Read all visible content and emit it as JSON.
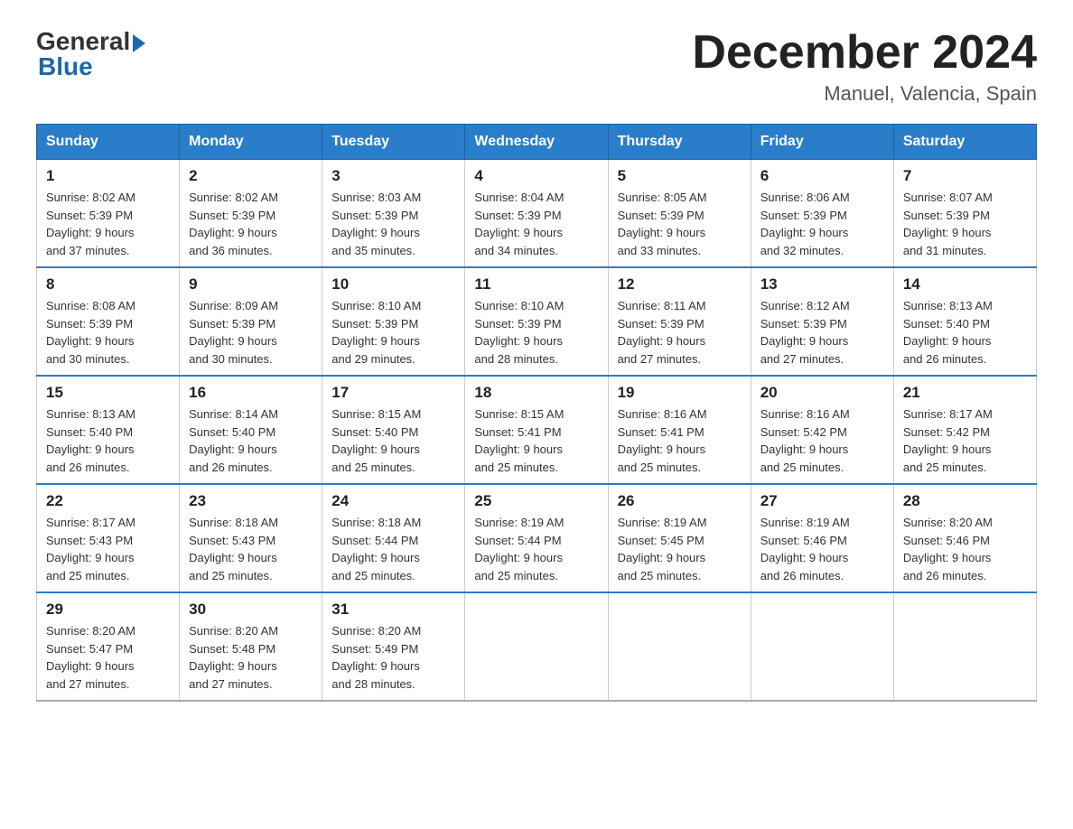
{
  "logo": {
    "general": "General",
    "blue": "Blue"
  },
  "title": "December 2024",
  "subtitle": "Manuel, Valencia, Spain",
  "days_of_week": [
    "Sunday",
    "Monday",
    "Tuesday",
    "Wednesday",
    "Thursday",
    "Friday",
    "Saturday"
  ],
  "weeks": [
    [
      {
        "day": "1",
        "sunrise": "8:02 AM",
        "sunset": "5:39 PM",
        "daylight": "9 hours and 37 minutes."
      },
      {
        "day": "2",
        "sunrise": "8:02 AM",
        "sunset": "5:39 PM",
        "daylight": "9 hours and 36 minutes."
      },
      {
        "day": "3",
        "sunrise": "8:03 AM",
        "sunset": "5:39 PM",
        "daylight": "9 hours and 35 minutes."
      },
      {
        "day": "4",
        "sunrise": "8:04 AM",
        "sunset": "5:39 PM",
        "daylight": "9 hours and 34 minutes."
      },
      {
        "day": "5",
        "sunrise": "8:05 AM",
        "sunset": "5:39 PM",
        "daylight": "9 hours and 33 minutes."
      },
      {
        "day": "6",
        "sunrise": "8:06 AM",
        "sunset": "5:39 PM",
        "daylight": "9 hours and 32 minutes."
      },
      {
        "day": "7",
        "sunrise": "8:07 AM",
        "sunset": "5:39 PM",
        "daylight": "9 hours and 31 minutes."
      }
    ],
    [
      {
        "day": "8",
        "sunrise": "8:08 AM",
        "sunset": "5:39 PM",
        "daylight": "9 hours and 30 minutes."
      },
      {
        "day": "9",
        "sunrise": "8:09 AM",
        "sunset": "5:39 PM",
        "daylight": "9 hours and 30 minutes."
      },
      {
        "day": "10",
        "sunrise": "8:10 AM",
        "sunset": "5:39 PM",
        "daylight": "9 hours and 29 minutes."
      },
      {
        "day": "11",
        "sunrise": "8:10 AM",
        "sunset": "5:39 PM",
        "daylight": "9 hours and 28 minutes."
      },
      {
        "day": "12",
        "sunrise": "8:11 AM",
        "sunset": "5:39 PM",
        "daylight": "9 hours and 27 minutes."
      },
      {
        "day": "13",
        "sunrise": "8:12 AM",
        "sunset": "5:39 PM",
        "daylight": "9 hours and 27 minutes."
      },
      {
        "day": "14",
        "sunrise": "8:13 AM",
        "sunset": "5:40 PM",
        "daylight": "9 hours and 26 minutes."
      }
    ],
    [
      {
        "day": "15",
        "sunrise": "8:13 AM",
        "sunset": "5:40 PM",
        "daylight": "9 hours and 26 minutes."
      },
      {
        "day": "16",
        "sunrise": "8:14 AM",
        "sunset": "5:40 PM",
        "daylight": "9 hours and 26 minutes."
      },
      {
        "day": "17",
        "sunrise": "8:15 AM",
        "sunset": "5:40 PM",
        "daylight": "9 hours and 25 minutes."
      },
      {
        "day": "18",
        "sunrise": "8:15 AM",
        "sunset": "5:41 PM",
        "daylight": "9 hours and 25 minutes."
      },
      {
        "day": "19",
        "sunrise": "8:16 AM",
        "sunset": "5:41 PM",
        "daylight": "9 hours and 25 minutes."
      },
      {
        "day": "20",
        "sunrise": "8:16 AM",
        "sunset": "5:42 PM",
        "daylight": "9 hours and 25 minutes."
      },
      {
        "day": "21",
        "sunrise": "8:17 AM",
        "sunset": "5:42 PM",
        "daylight": "9 hours and 25 minutes."
      }
    ],
    [
      {
        "day": "22",
        "sunrise": "8:17 AM",
        "sunset": "5:43 PM",
        "daylight": "9 hours and 25 minutes."
      },
      {
        "day": "23",
        "sunrise": "8:18 AM",
        "sunset": "5:43 PM",
        "daylight": "9 hours and 25 minutes."
      },
      {
        "day": "24",
        "sunrise": "8:18 AM",
        "sunset": "5:44 PM",
        "daylight": "9 hours and 25 minutes."
      },
      {
        "day": "25",
        "sunrise": "8:19 AM",
        "sunset": "5:44 PM",
        "daylight": "9 hours and 25 minutes."
      },
      {
        "day": "26",
        "sunrise": "8:19 AM",
        "sunset": "5:45 PM",
        "daylight": "9 hours and 25 minutes."
      },
      {
        "day": "27",
        "sunrise": "8:19 AM",
        "sunset": "5:46 PM",
        "daylight": "9 hours and 26 minutes."
      },
      {
        "day": "28",
        "sunrise": "8:20 AM",
        "sunset": "5:46 PM",
        "daylight": "9 hours and 26 minutes."
      }
    ],
    [
      {
        "day": "29",
        "sunrise": "8:20 AM",
        "sunset": "5:47 PM",
        "daylight": "9 hours and 27 minutes."
      },
      {
        "day": "30",
        "sunrise": "8:20 AM",
        "sunset": "5:48 PM",
        "daylight": "9 hours and 27 minutes."
      },
      {
        "day": "31",
        "sunrise": "8:20 AM",
        "sunset": "5:49 PM",
        "daylight": "9 hours and 28 minutes."
      },
      null,
      null,
      null,
      null
    ]
  ],
  "labels": {
    "sunrise": "Sunrise:",
    "sunset": "Sunset:",
    "daylight": "Daylight:"
  }
}
